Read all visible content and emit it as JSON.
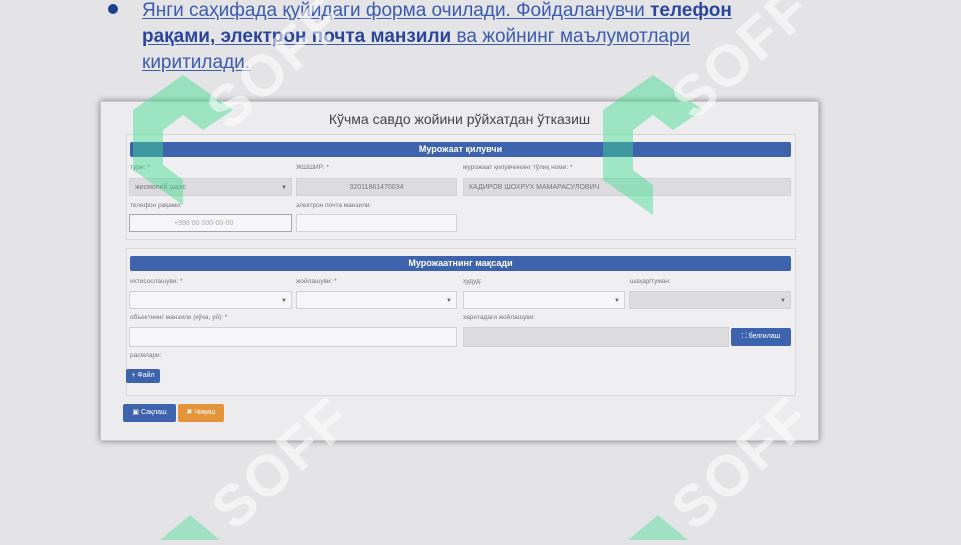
{
  "bullet": {
    "text_before": "Янги саҳифада қуйидаги форма очилади. Фойдаланувчи ",
    "bold": "телефон рақами, электрон почта манзили",
    "text_after": " ва жойнинг маълумотлари киритилади."
  },
  "form": {
    "title": "Кўчма савдо жойини рўйхатдан ўтказиш",
    "section1": {
      "header": "Мурожаат қилувчи",
      "type_label": "тури: *",
      "type_value": "жисмоний шахс",
      "jshshir_label": "ЖШШИР: *",
      "jshshir_value": "32011861470034",
      "fullname_label": "мурожаат қилувчининг тўлиқ номи: *",
      "fullname_value": "КАДИРОВ ШОХРУХ МАМАРАСУЛОВИЧ",
      "phone_label": "телефон рақами:",
      "phone_placeholder": "+998 00 000-00-00",
      "email_label": "электрон почта манзили:"
    },
    "section2": {
      "header": "Мурожаатнинг мақсади",
      "specialization_label": "ихтисослашуви: *",
      "place_label": "жойлашуви: *",
      "region_label": "ҳудуд:",
      "district_label": "шаҳар/туман:",
      "address_label": "объектнинг манзили (кўча, уй): *",
      "map_label": "харитадаги жойлашуви:",
      "map_button": "белгилаш",
      "photos_label": "расмлари:",
      "file_button": "+ Файл"
    },
    "save_button": "Сақлаш",
    "cancel_button": "Чиқиш"
  },
  "watermark": "SOFF",
  "colors": {
    "accent_blue": "#3d63ad",
    "cancel_orange": "#e4953a",
    "bullet_text": "#3a5bb0",
    "watermark_green": "#3ddc8f"
  }
}
